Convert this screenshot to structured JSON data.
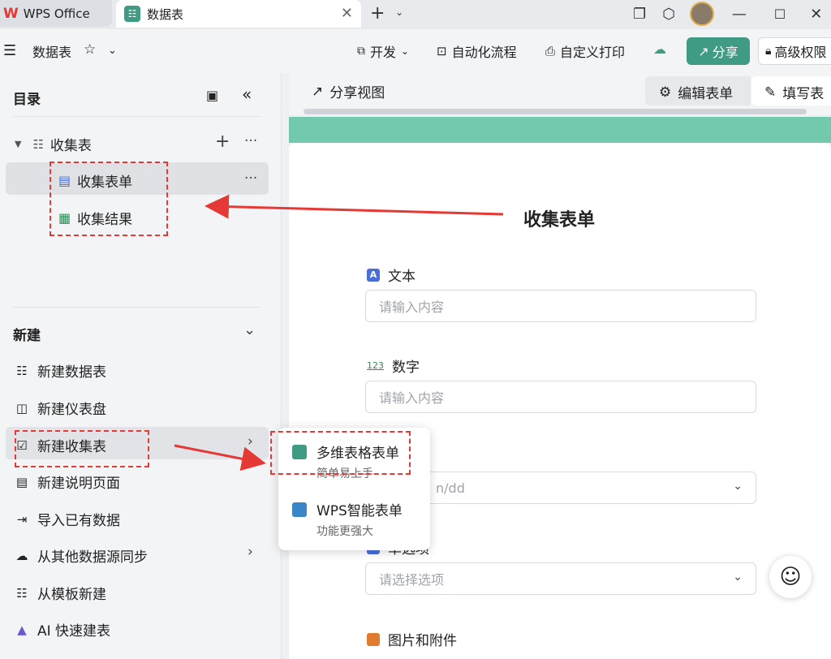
{
  "tabs": [
    {
      "label": "WPS Office"
    },
    {
      "label": "数据表"
    }
  ],
  "toolbar": {
    "doc_title": "数据表",
    "develop": "开发",
    "automation": "自动化流程",
    "custom_print": "自定义打印",
    "share": "分享",
    "permission": "高级权限"
  },
  "sidebar": {
    "title": "目录",
    "tree": {
      "parent": "收集表",
      "children": [
        {
          "label": "收集表单"
        },
        {
          "label": "收集结果"
        }
      ]
    },
    "new_section": "新建",
    "new_items": [
      {
        "label": "新建数据表",
        "icon": "table-list-icon"
      },
      {
        "label": "新建仪表盘",
        "icon": "dashboard-icon"
      },
      {
        "label": "新建收集表",
        "icon": "form-check-icon"
      },
      {
        "label": "新建说明页面",
        "icon": "document-icon"
      },
      {
        "label": "导入已有数据",
        "icon": "import-icon"
      },
      {
        "label": "从其他数据源同步",
        "icon": "cloud-icon"
      },
      {
        "label": "从模板新建",
        "icon": "template-icon"
      },
      {
        "label": "AI 快速建表",
        "icon": "ai-icon"
      }
    ]
  },
  "viewbar": {
    "share_view": "分享视图",
    "edit_form": "编辑表单",
    "fill_form": "填写表"
  },
  "form": {
    "title": "收集表单",
    "fields": [
      {
        "label": "文本",
        "placeholder": "请输入内容",
        "icon_text": "A"
      },
      {
        "label": "数字",
        "placeholder": "请输入内容",
        "icon_text": "123"
      },
      {
        "label": "",
        "placeholder": "n/dd",
        "icon_text": ""
      },
      {
        "label": "单选项",
        "placeholder": "请选择选项",
        "icon_text": ""
      },
      {
        "label": "图片和附件",
        "placeholder": "",
        "icon_text": ""
      }
    ]
  },
  "popup": {
    "items": [
      {
        "title": "多维表格表单",
        "subtitle": "简单易上手"
      },
      {
        "title": "WPS智能表单",
        "subtitle": "功能更强大"
      }
    ]
  },
  "colors": {
    "accent": "#3f9b84",
    "banner": "#72c9ae",
    "annotation": "#e53935"
  }
}
